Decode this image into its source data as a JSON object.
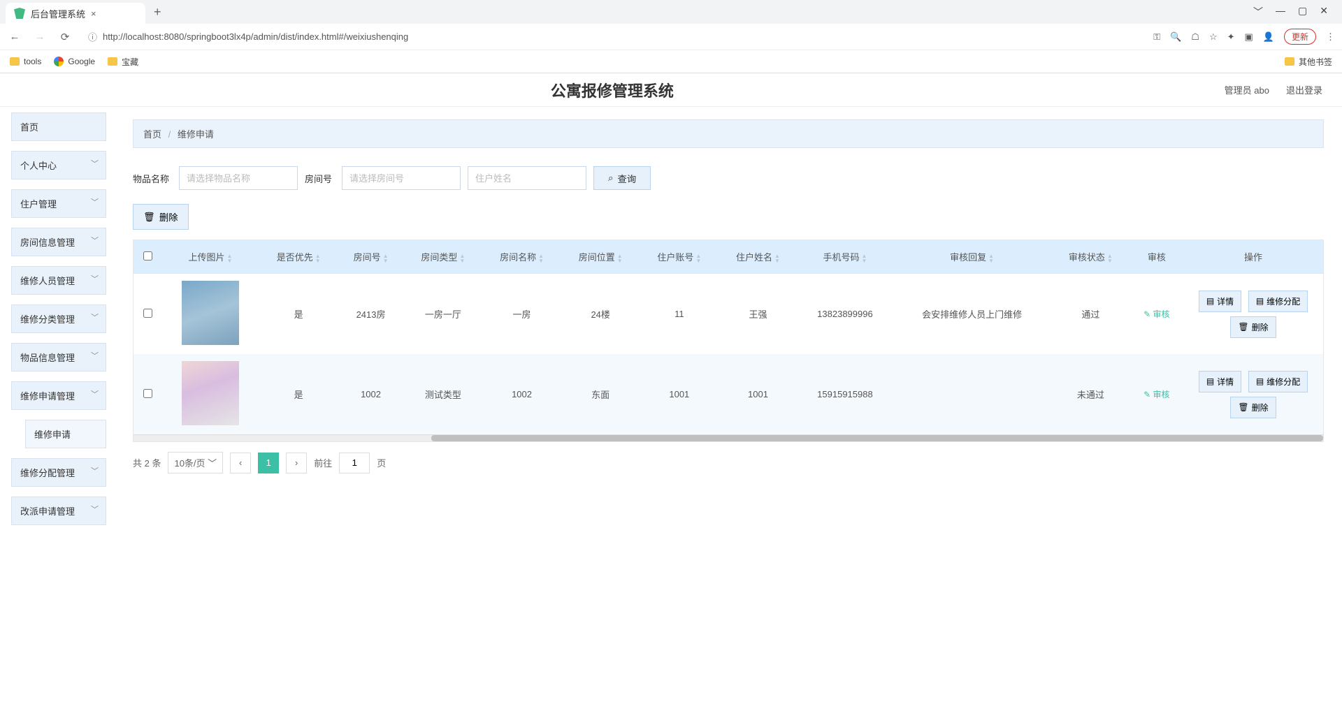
{
  "browser": {
    "tab_title": "后台管理系统",
    "url": "http://localhost:8080/springboot3lx4p/admin/dist/index.html#/weixiushenqing",
    "update_label": "更新",
    "bookmarks": {
      "tools": "tools",
      "google": "Google",
      "baozang": "宝藏",
      "other": "其他书签"
    }
  },
  "header": {
    "app_title": "公寓报修管理系统",
    "user_label": "管理员 abo",
    "logout_label": "退出登录"
  },
  "sidebar": {
    "items": [
      {
        "label": "首页",
        "expandable": false
      },
      {
        "label": "个人中心",
        "expandable": true
      },
      {
        "label": "住户管理",
        "expandable": true
      },
      {
        "label": "房间信息管理",
        "expandable": true
      },
      {
        "label": "维修人员管理",
        "expandable": true
      },
      {
        "label": "维修分类管理",
        "expandable": true
      },
      {
        "label": "物品信息管理",
        "expandable": true
      },
      {
        "label": "维修申请管理",
        "expandable": true
      },
      {
        "label": "维修申请",
        "expandable": false,
        "sub": true
      },
      {
        "label": "维修分配管理",
        "expandable": true
      },
      {
        "label": "改派申请管理",
        "expandable": true
      }
    ]
  },
  "breadcrumb": {
    "home": "首页",
    "current": "维修申请"
  },
  "search": {
    "field1_label": "物品名称",
    "field1_placeholder": "请选择物品名称",
    "field2_label": "房间号",
    "field2_placeholder": "请选择房间号",
    "field3_placeholder": "住户姓名",
    "query_label": "查询"
  },
  "batch_delete_label": "删除",
  "table": {
    "headers": [
      "上传图片",
      "是否优先",
      "房间号",
      "房间类型",
      "房间名称",
      "房间位置",
      "住户账号",
      "住户姓名",
      "手机号码",
      "审核回复",
      "审核状态",
      "审核",
      "操作"
    ],
    "rows": [
      {
        "priority": "是",
        "room_no": "2413房",
        "room_type": "一房一厅",
        "room_name": "一房",
        "room_pos": "24楼",
        "account": "11",
        "username": "王强",
        "phone": "13823899996",
        "reply": "会安排维修人员上门维修",
        "status": "通过"
      },
      {
        "priority": "是",
        "room_no": "1002",
        "room_type": "测试类型",
        "room_name": "1002",
        "room_pos": "东面",
        "account": "1001",
        "username": "1001",
        "phone": "15915915988",
        "reply": "",
        "status": "未通过"
      }
    ],
    "audit_link_label": "审核",
    "op_detail": "详情",
    "op_assign": "维修分配",
    "op_delete": "删除"
  },
  "pagination": {
    "total_text": "共 2 条",
    "page_size": "10条/页",
    "goto_prefix": "前往",
    "current_page": "1",
    "goto_suffix": "页"
  }
}
